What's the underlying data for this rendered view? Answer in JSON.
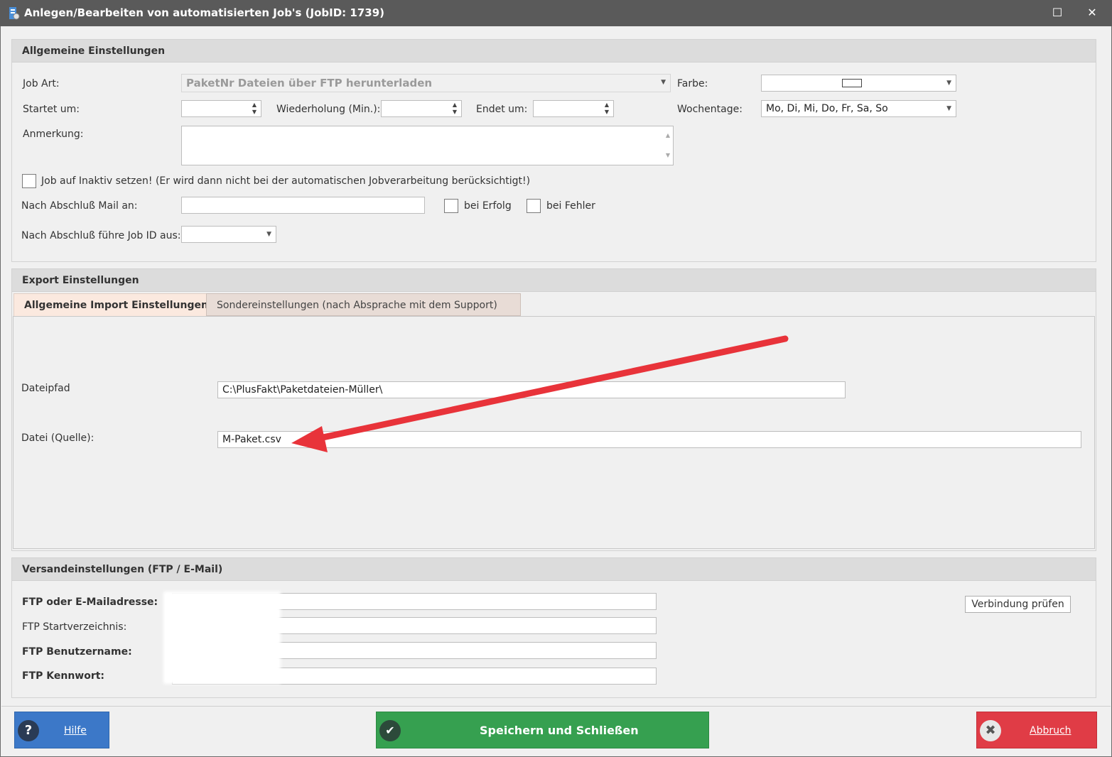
{
  "window": {
    "title": "Anlegen/Bearbeiten von automatisierten Job's (JobID: 1739)",
    "maximize_glyph": "☐",
    "close_glyph": "✕"
  },
  "general": {
    "header": "Allgemeine Einstellungen",
    "job_art_label": "Job Art:",
    "job_art_value": "PaketNr Dateien über FTP herunterladen",
    "farbe_label": "Farbe:",
    "startet_label": "Startet um:",
    "startet_value": "",
    "wiederholung_label": "Wiederholung (Min.):",
    "wiederholung_value": "",
    "endet_label": "Endet um:",
    "endet_value": "",
    "wochentage_label": "Wochentage:",
    "wochentage_value": "Mo, Di, Mi, Do, Fr, Sa, So",
    "anmerkung_label": "Anmerkung:",
    "anmerkung_value": "",
    "inaktiv_label": "Job auf Inaktiv setzen! (Er wird dann nicht bei der automatischen Jobverarbeitung berücksichtigt!)",
    "inaktiv_checked": false,
    "mail_label": "Nach Abschluß Mail an:",
    "mail_value": "",
    "bei_erfolg_label": "bei Erfolg",
    "bei_erfolg_checked": false,
    "bei_fehler_label": "bei Fehler",
    "bei_fehler_checked": false,
    "next_job_label": "Nach Abschluß führe Job ID aus:",
    "next_job_value": ""
  },
  "export": {
    "header": "Export Einstellungen",
    "tabs": [
      {
        "label": "Allgemeine Import Einstellungen",
        "active": true
      },
      {
        "label": "Sondereinstellungen (nach Absprache mit dem Support)",
        "active": false
      }
    ],
    "dateipfad_label": "Dateipfad",
    "dateipfad_value": "C:\\PlusFakt\\Paketdateien-Müller\\",
    "datei_label": "Datei (Quelle):",
    "datei_value": "M-Paket.csv",
    "annotation_color": "#e8333a"
  },
  "versand": {
    "header": "Versandeinstellungen (FTP / E-Mail)",
    "ftp_address_label": "FTP oder E-Mailadresse:",
    "ftp_start_label": "FTP Startverzeichnis:",
    "ftp_user_label": "FTP Benutzername:",
    "ftp_password_label": "FTP Kennwort:",
    "verbindung_button": "Verbindung prüfen"
  },
  "footer": {
    "hilfe": "Hilfe",
    "speichern": "Speichern und Schließen",
    "abbruch": "Abbruch",
    "colors": {
      "hilfe": "#3c78c8",
      "speichern": "#36a050",
      "abbruch": "#e03c46"
    }
  }
}
